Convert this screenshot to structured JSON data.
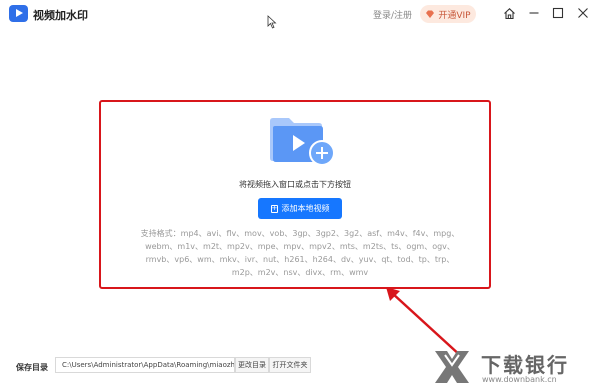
{
  "window": {
    "title": "视频加水印",
    "login_text": "登录/注册",
    "vip_label": "开通VIP",
    "controls": [
      "home-icon",
      "minimize-icon",
      "maximize-icon",
      "close-icon"
    ]
  },
  "drop_area": {
    "hint": "将视频拖入窗口或点击下方按钮",
    "add_button_label": "添加本地视频",
    "formats_text": "支持格式：mp4、avi、flv、mov、vob、3gp、3gp2、3g2、asf、m4v、f4v、mpg、webm、m1v、m2t、mp2v、mpe、mpv、mpv2、mts、m2ts、ts、ogm、ogv、rmvb、vp6、wm、mkv、ivr、nut、h261、h264、dv、yuv、qt、tod、tp、trp、m2p、m2v、nsv、divx、rm、wmv"
  },
  "footer": {
    "save_dir_label": "保存目录",
    "path_value": "C:\\Users\\Administrator\\AppData\\Roaming\\miaozhu...",
    "change_dir_label": "更改目录",
    "open_folder_label": "打开文件夹"
  },
  "watermark": {
    "text_cn": "下载银行",
    "text_en": "www.downbank.cn"
  },
  "colors": {
    "accent": "#1677ff",
    "highlight_border": "#d8161b",
    "vip_bg": "#fde9df",
    "vip_text": "#c8583a"
  }
}
